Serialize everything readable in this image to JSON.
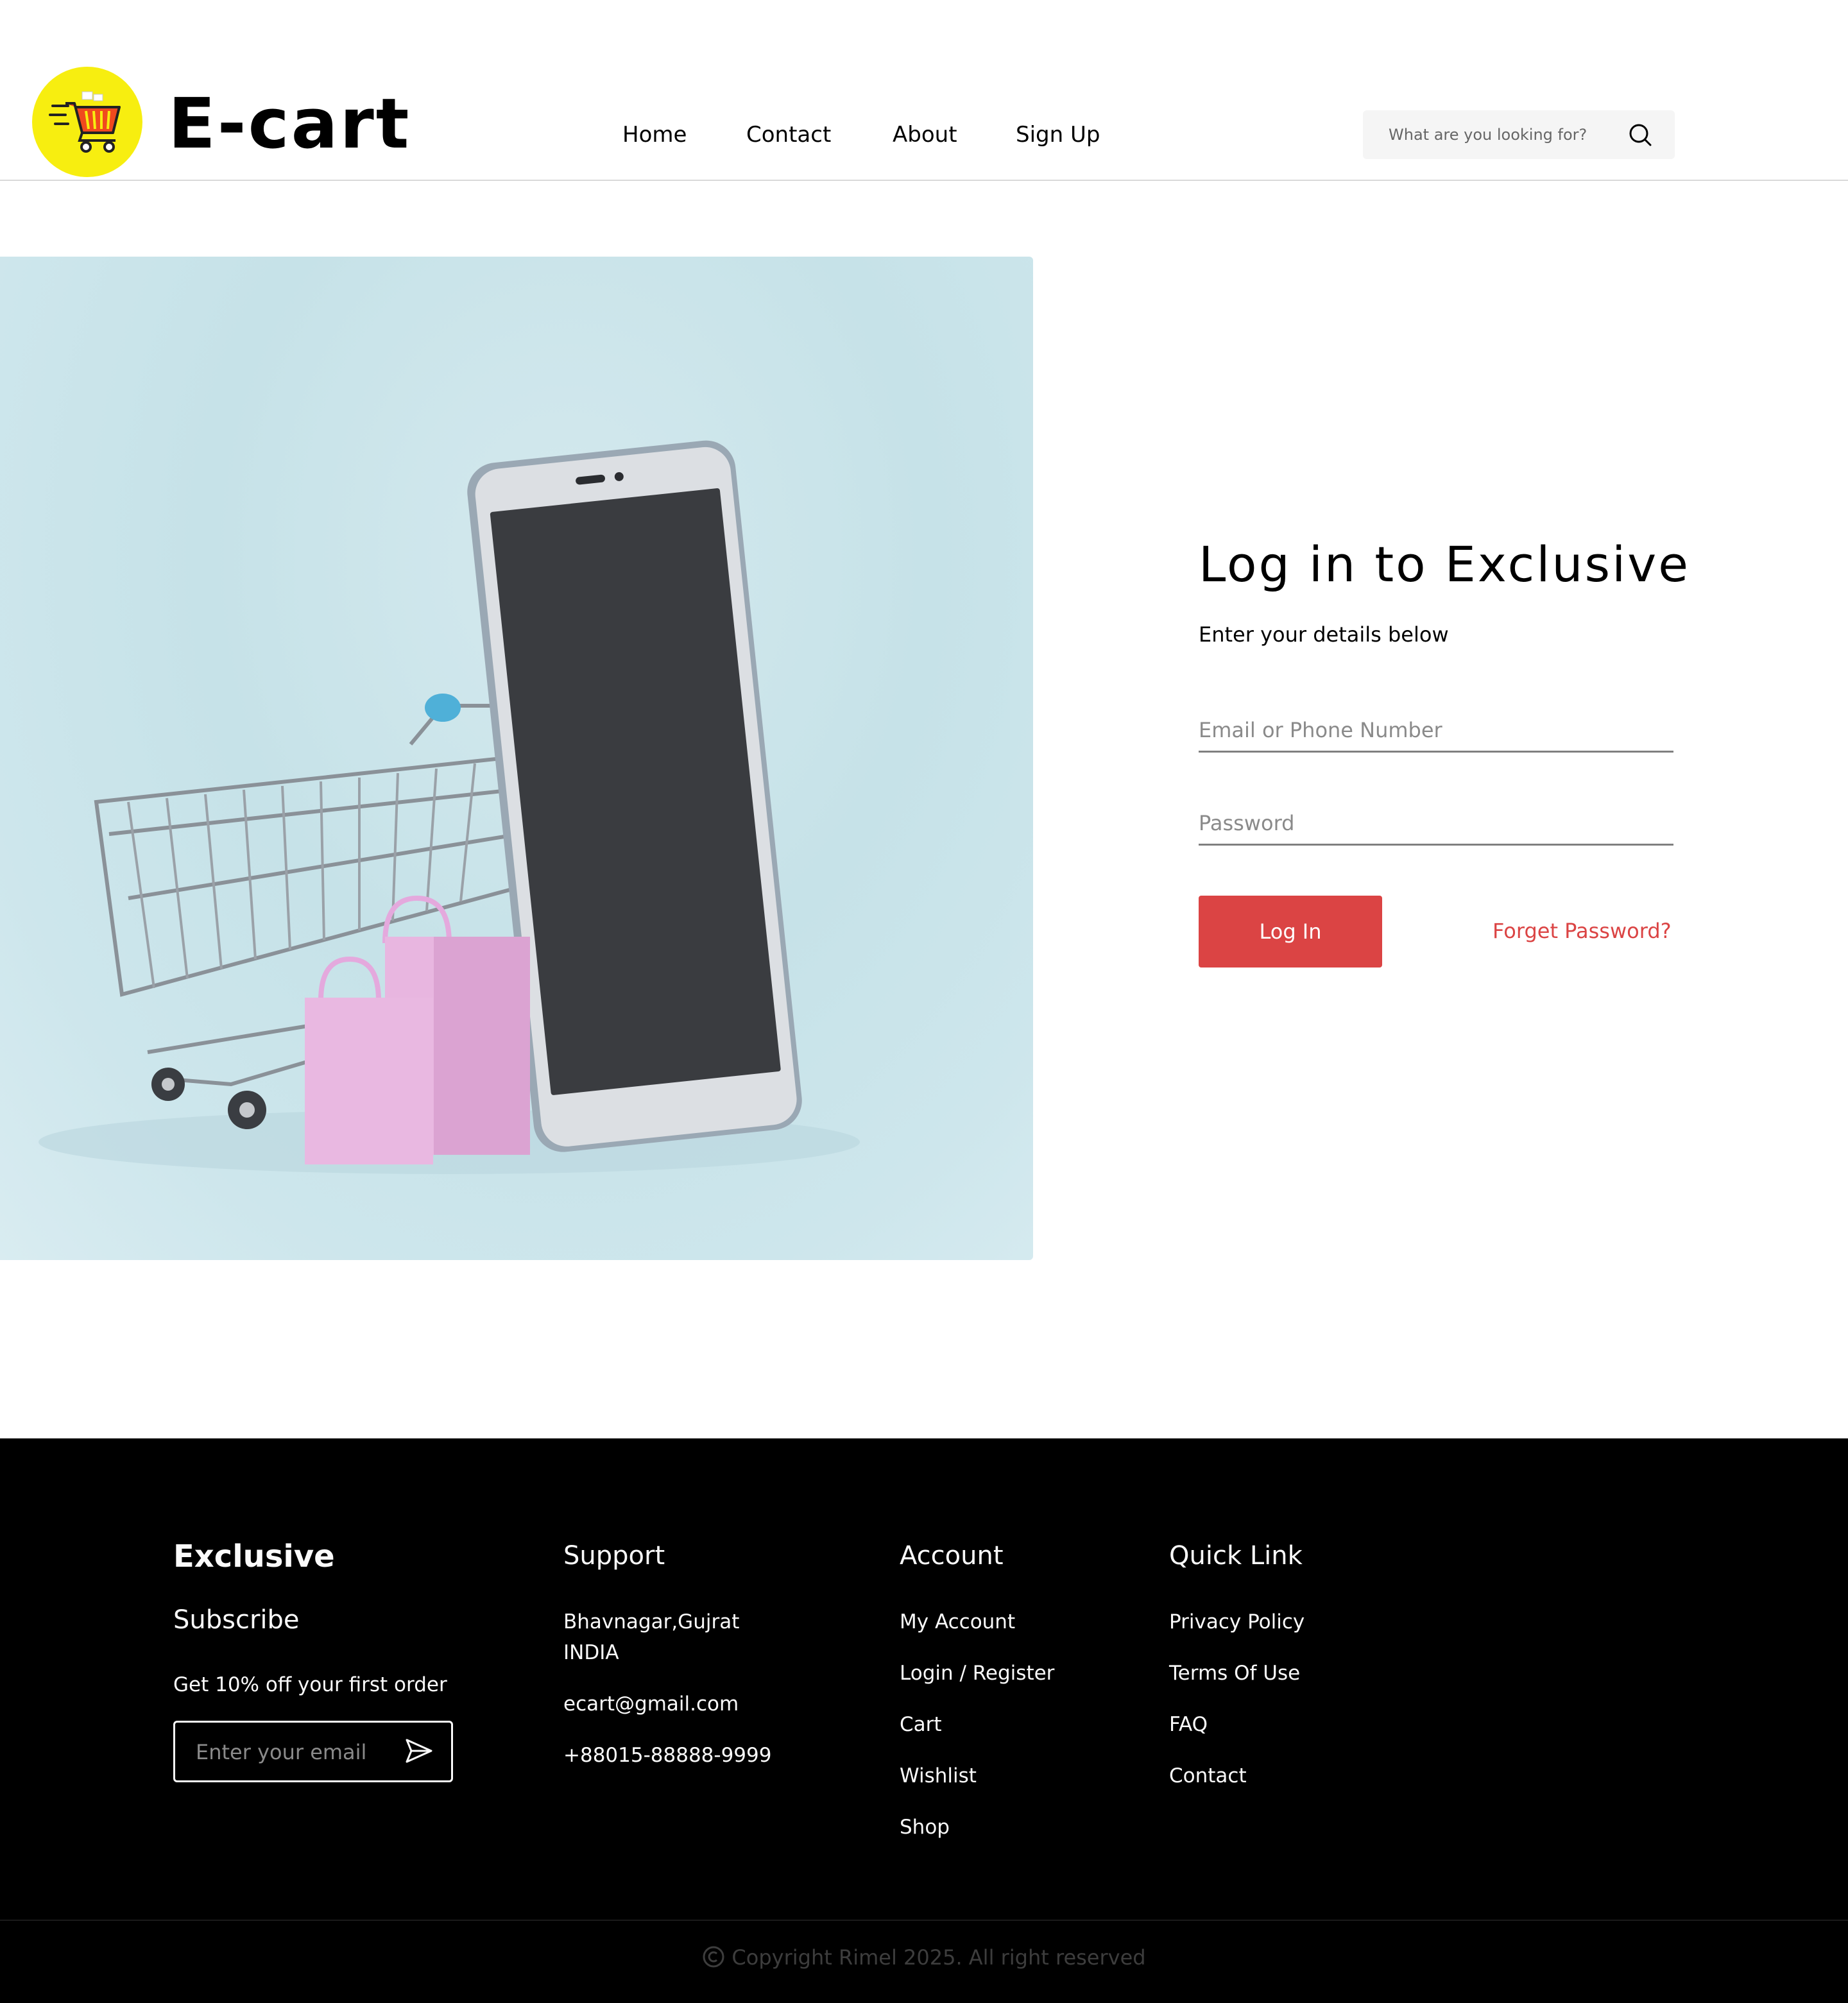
{
  "header": {
    "brand": "E-cart",
    "nav": [
      "Home",
      "Contact",
      "About",
      "Sign Up"
    ],
    "search_placeholder": "What are you looking for?"
  },
  "login": {
    "title": "Log in to Exclusive",
    "subtitle": "Enter your details below",
    "email_placeholder": "Email or Phone Number",
    "password_placeholder": "Password",
    "login_button": "Log In",
    "forgot_link": "Forget Password?"
  },
  "footer": {
    "col1": {
      "title": "Exclusive",
      "subtitle": "Subscribe",
      "offer": "Get 10% off your first order",
      "email_placeholder": "Enter your email"
    },
    "support": {
      "title": "Support",
      "address_line1": "Bhavnagar,Gujrat",
      "address_line2": "INDIA",
      "email": "ecart@gmail.com",
      "phone": "+88015-88888-9999"
    },
    "account": {
      "title": "Account",
      "items": [
        "My Account",
        "Login / Register",
        "Cart",
        "Wishlist",
        "Shop"
      ]
    },
    "quick_link": {
      "title": "Quick Link",
      "items": [
        "Privacy Policy",
        "Terms Of Use",
        "FAQ",
        "Contact"
      ]
    },
    "copyright": "Copyright Rimel 2025. All right reserved"
  },
  "colors": {
    "accent": "#DB4444",
    "logo_yellow": "#F7EE10",
    "footer_bg": "#000000"
  }
}
